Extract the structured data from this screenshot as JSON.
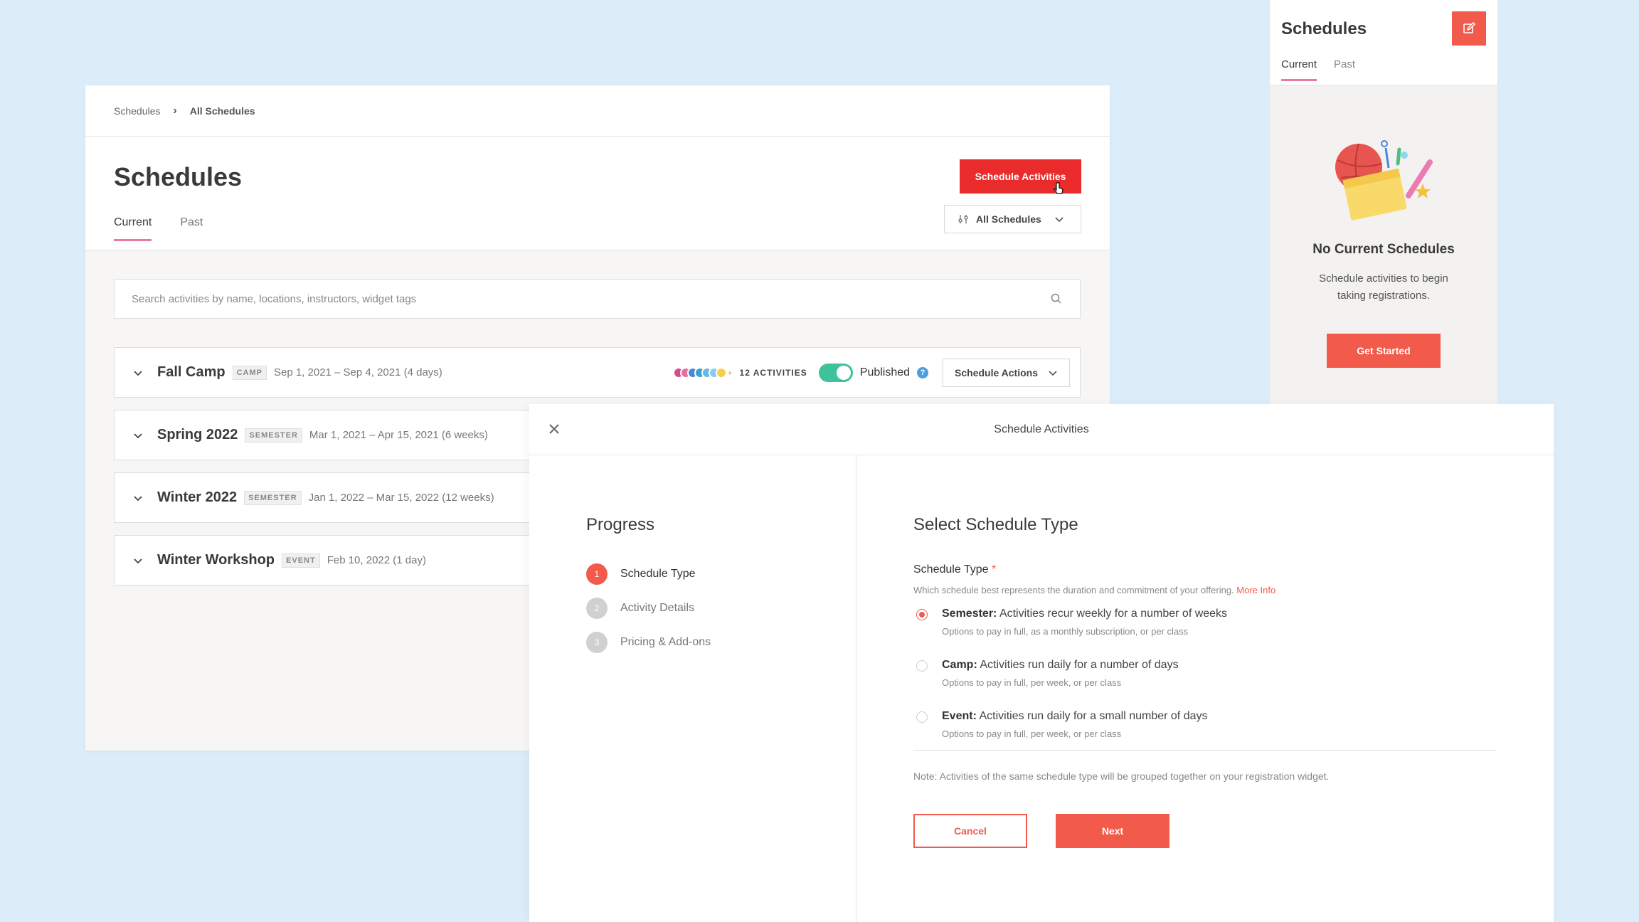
{
  "main": {
    "breadcrumb": {
      "parent": "Schedules",
      "current": "All Schedules"
    },
    "title": "Schedules",
    "tabs": [
      {
        "label": "Current"
      },
      {
        "label": "Past"
      }
    ],
    "primary_button": "Schedule Activities",
    "filter_label": "All Schedules",
    "search_placeholder": "Search activities by name, locations, instructors, widget tags",
    "schedules": [
      {
        "name": "Fall Camp",
        "tag": "CAMP",
        "dates": "Sep 1, 2021 – Sep 4, 2021 (4 days)",
        "activities": "12 ACTIVITIES",
        "status": "Published",
        "actions_label": "Schedule Actions"
      },
      {
        "name": "Spring 2022",
        "tag": "SEMESTER",
        "dates": "Mar 1, 2021 – Apr 15, 2021 (6 weeks)"
      },
      {
        "name": "Winter 2022",
        "tag": "SEMESTER",
        "dates": "Jan 1, 2022 – Mar 15, 2022 (12 weeks)"
      },
      {
        "name": "Winter Workshop",
        "tag": "EVENT",
        "dates": "Feb 10, 2022 (1 day)"
      }
    ],
    "activity_dot_colors": [
      "#d9488f",
      "#e3739a",
      "#4a86d8",
      "#3aa3c8",
      "#6ab7e8",
      "#8cc8f0",
      "#f2cf52"
    ],
    "activity_dot_more": "+",
    "help_icon_glyph": "?"
  },
  "side": {
    "title": "Schedules",
    "tabs": [
      {
        "label": "Current"
      },
      {
        "label": "Past"
      }
    ],
    "empty_title": "No Current Schedules",
    "empty_desc": "Schedule activities to begin taking registrations.",
    "cta": "Get Started"
  },
  "modal": {
    "title": "Schedule Activities",
    "progress_title": "Progress",
    "steps": [
      {
        "num": "1",
        "label": "Schedule Type"
      },
      {
        "num": "2",
        "label": "Activity Details"
      },
      {
        "num": "3",
        "label": "Pricing & Add-ons"
      }
    ],
    "section_title": "Select Schedule Type",
    "field_label": "Schedule Type",
    "required_mark": "*",
    "field_help": "Which schedule best represents the duration and commitment of your offering.",
    "more_info": "More Info",
    "options": [
      {
        "name": "Semester:",
        "desc": "Activities recur weekly for a number of weeks",
        "sub": "Options to pay in full, as a monthly subscription, or per class",
        "selected": true
      },
      {
        "name": "Camp:",
        "desc": "Activities run daily for a number of days",
        "sub": "Options to pay in full, per week, or per class",
        "selected": false
      },
      {
        "name": "Event:",
        "desc": "Activities run daily for a small number of days",
        "sub": "Options to pay in full, per week, or per class",
        "selected": false
      }
    ],
    "note": "Note: Activities of the same schedule type will be grouped together on your registration widget.",
    "cancel": "Cancel",
    "next": "Next"
  },
  "colors": {
    "accent": "#f25a4c",
    "primary_button": "#e92b2b",
    "toggle_on": "#3ec29c",
    "tab_underline": "#e87aa0",
    "background": "#dcedf9"
  }
}
